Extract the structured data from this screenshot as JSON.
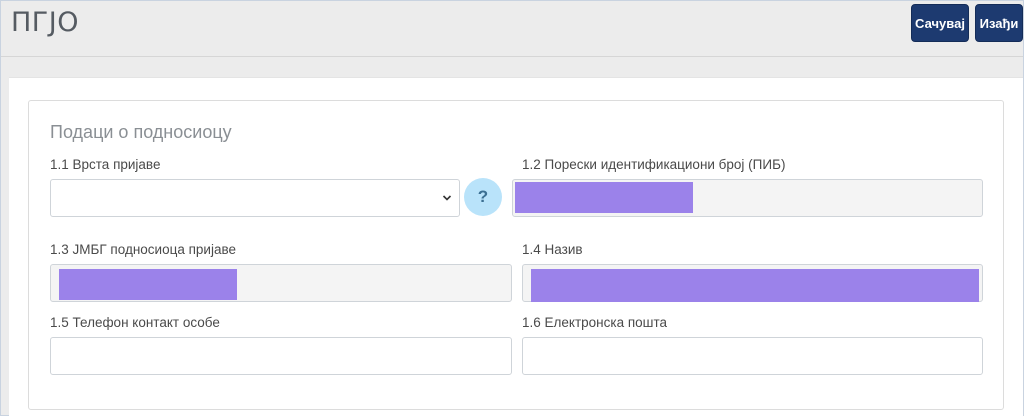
{
  "app": {
    "title": "ПГЈО"
  },
  "toolbar": {
    "save_label": "Сачувај",
    "exit_label": "Изађи"
  },
  "section": {
    "title": "Подаци о подносиоцу"
  },
  "fields": {
    "type": {
      "label": "1.1 Врста пријаве",
      "value": ""
    },
    "pib": {
      "label": "1.2 Порески идентификациони број (ПИБ)"
    },
    "jmbg": {
      "label": "1.3 ЈМБГ подносиоца пријаве"
    },
    "name": {
      "label": "1.4 Назив"
    },
    "phone": {
      "label": "1.5 Телефон контакт особе",
      "value": ""
    },
    "email": {
      "label": "1.6 Електронска пошта",
      "value": ""
    }
  },
  "help": {
    "symbol": "?"
  },
  "icons": {
    "chevron": "chevron-down-icon",
    "help": "question-icon"
  },
  "colors": {
    "primary": "#1d3a70",
    "redaction": "#9b82ea",
    "help_bg": "#b9e3fa"
  }
}
